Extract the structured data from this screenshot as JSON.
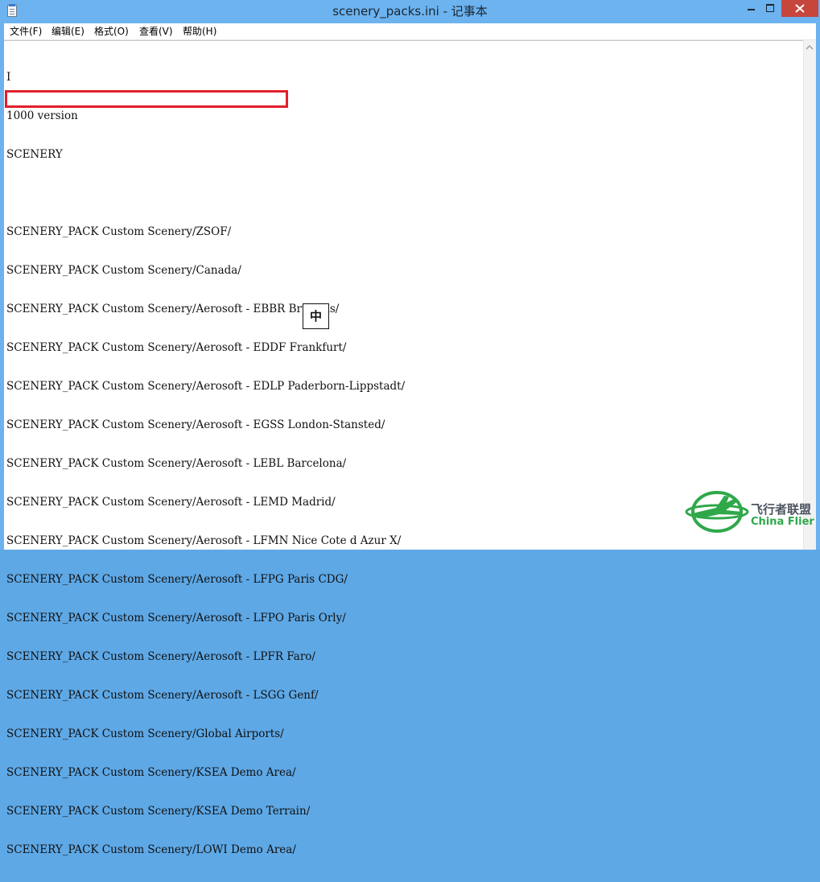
{
  "window": {
    "title": "scenery_packs.ini - 记事本"
  },
  "menu": {
    "items": [
      {
        "label": "文件(F)"
      },
      {
        "label": "编辑(E)"
      },
      {
        "label": "格式(O)"
      },
      {
        "label": "查看(V)"
      },
      {
        "label": "帮助(H)"
      }
    ]
  },
  "document": {
    "lines": [
      "I",
      "1000 version",
      "SCENERY",
      "",
      "SCENERY_PACK Custom Scenery/ZSOF/",
      "SCENERY_PACK Custom Scenery/Canada/",
      "SCENERY_PACK Custom Scenery/Aerosoft - EBBR Brussels/",
      "SCENERY_PACK Custom Scenery/Aerosoft - EDDF Frankfurt/",
      "SCENERY_PACK Custom Scenery/Aerosoft - EDLP Paderborn-Lippstadt/",
      "SCENERY_PACK Custom Scenery/Aerosoft - EGSS London-Stansted/",
      "SCENERY_PACK Custom Scenery/Aerosoft - LEBL Barcelona/",
      "SCENERY_PACK Custom Scenery/Aerosoft - LEMD Madrid/",
      "SCENERY_PACK Custom Scenery/Aerosoft - LFMN Nice Cote d Azur X/",
      "SCENERY_PACK Custom Scenery/Aerosoft - LFPG Paris CDG/",
      "SCENERY_PACK Custom Scenery/Aerosoft - LFPO Paris Orly/",
      "SCENERY_PACK Custom Scenery/Aerosoft - LPFR Faro/",
      "SCENERY_PACK Custom Scenery/Aerosoft - LSGG Genf/",
      "SCENERY_PACK Custom Scenery/Global Airports/",
      "SCENERY_PACK Custom Scenery/KSEA Demo Area/",
      "SCENERY_PACK Custom Scenery/KSEA Demo Terrain/",
      "SCENERY_PACK Custom Scenery/LOWI Demo Area/"
    ]
  },
  "ime": {
    "mode": "中"
  },
  "watermark": {
    "chinese": "飞行者联盟",
    "english": "China Flier"
  },
  "colors": {
    "highlight_border": "#e0202a",
    "titlebar": "#6cb3ef",
    "close_button": "#c7463c",
    "watermark_green": "#2fa84a"
  }
}
